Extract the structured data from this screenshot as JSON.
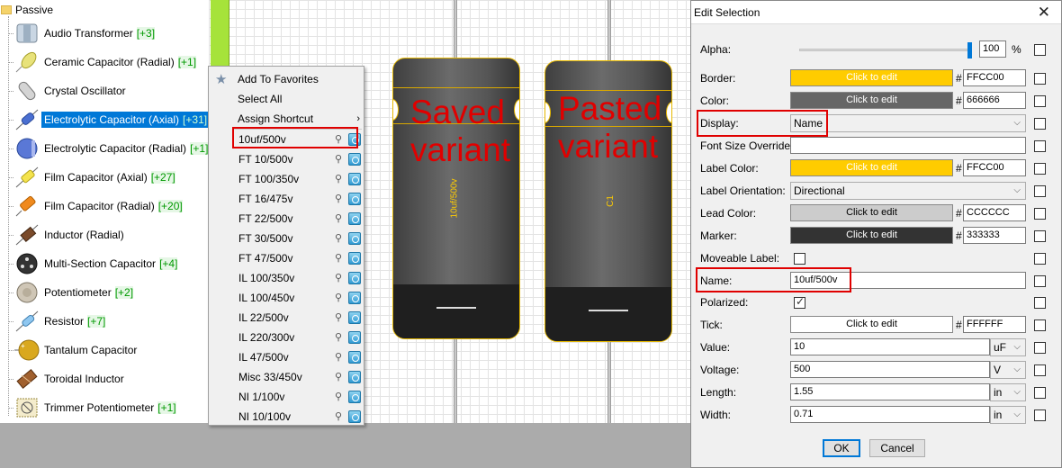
{
  "tree": {
    "category": "Passive",
    "items": [
      {
        "label": "Audio Transformer",
        "count": "[+3]",
        "icon": "audio-transformer-icon"
      },
      {
        "label": "Ceramic Capacitor (Radial)",
        "count": "[+1]",
        "icon": "ceramic-capacitor-icon"
      },
      {
        "label": "Crystal Oscillator",
        "count": "",
        "icon": "crystal-oscillator-icon"
      },
      {
        "label": "Electrolytic Capacitor (Axial)",
        "count": "[+31]",
        "icon": "electrolytic-axial-icon",
        "selected": true
      },
      {
        "label": "Electrolytic Capacitor (Radial)",
        "count": "[+1]",
        "icon": "electrolytic-radial-icon"
      },
      {
        "label": "Film Capacitor (Axial)",
        "count": "[+27]",
        "icon": "film-axial-icon"
      },
      {
        "label": "Film Capacitor (Radial)",
        "count": "[+20]",
        "icon": "film-radial-icon"
      },
      {
        "label": "Inductor (Radial)",
        "count": "",
        "icon": "inductor-icon"
      },
      {
        "label": "Multi-Section Capacitor",
        "count": "[+4]",
        "icon": "multi-section-icon"
      },
      {
        "label": "Potentiometer",
        "count": "[+2]",
        "icon": "potentiometer-icon"
      },
      {
        "label": "Resistor",
        "count": "[+7]",
        "icon": "resistor-icon"
      },
      {
        "label": "Tantalum Capacitor",
        "count": "",
        "icon": "tantalum-icon"
      },
      {
        "label": "Toroidal Inductor",
        "count": "",
        "icon": "toroid-icon"
      },
      {
        "label": "Trimmer Potentiometer",
        "count": "[+1]",
        "icon": "trimmer-icon"
      }
    ]
  },
  "context_menu": {
    "add_favorites": "Add To Favorites",
    "select_all": "Select All",
    "assign_shortcut": "Assign Shortcut",
    "variants": [
      "10uf/500v",
      "FT 10/500v",
      "FT 100/350v",
      "FT 16/475v",
      "FT 22/500v",
      "FT 30/500v",
      "FT 47/500v",
      "IL 100/350v",
      "IL 100/450v",
      "IL 22/500v",
      "IL 220/300v",
      "IL 47/500v",
      "Misc 33/450v",
      "NI 1/100v",
      "NI 10/100v"
    ]
  },
  "canvas": {
    "saved_annotation_line1": "Saved",
    "saved_annotation_line2": "variant",
    "pasted_annotation_line1": "Pasted",
    "pasted_annotation_line2": "variant",
    "saved_cap_label": "10uf/500v",
    "pasted_cap_label": "C1"
  },
  "dialog": {
    "title": "Edit Selection",
    "close": "✕",
    "alpha_label": "Alpha:",
    "alpha_value": "100",
    "alpha_unit": "%",
    "alpha_level": 1.0,
    "click_to_edit": "Click to edit",
    "hash": "#",
    "border_label": "Border:",
    "border_hex": "FFCC00",
    "border_color": "#FFCC00",
    "color_label": "Color:",
    "color_hex": "666666",
    "color_color": "#666666",
    "display_label": "Display:",
    "display_value": "Name",
    "font_size_label": "Font Size Override:",
    "font_size_value": "",
    "label_color_label": "Label Color:",
    "label_color_hex": "FFCC00",
    "label_orientation_label": "Label Orientation:",
    "label_orientation_value": "Directional",
    "lead_color_label": "Lead Color:",
    "lead_color_hex": "CCCCCC",
    "marker_label": "Marker:",
    "marker_hex": "333333",
    "moveable_label": "Moveable Label:",
    "name_label": "Name:",
    "name_value": "10uf/500v",
    "polarized_label": "Polarized:",
    "tick_label": "Tick:",
    "tick_hex": "FFFFFF",
    "value_label": "Value:",
    "value_value": "10",
    "value_unit": "uF",
    "voltage_label": "Voltage:",
    "voltage_value": "500",
    "voltage_unit": "V",
    "length_label": "Length:",
    "length_value": "1.55",
    "length_unit": "in",
    "width_label": "Width:",
    "width_value": "0.71",
    "width_unit": "in",
    "ok": "OK",
    "cancel": "Cancel"
  }
}
